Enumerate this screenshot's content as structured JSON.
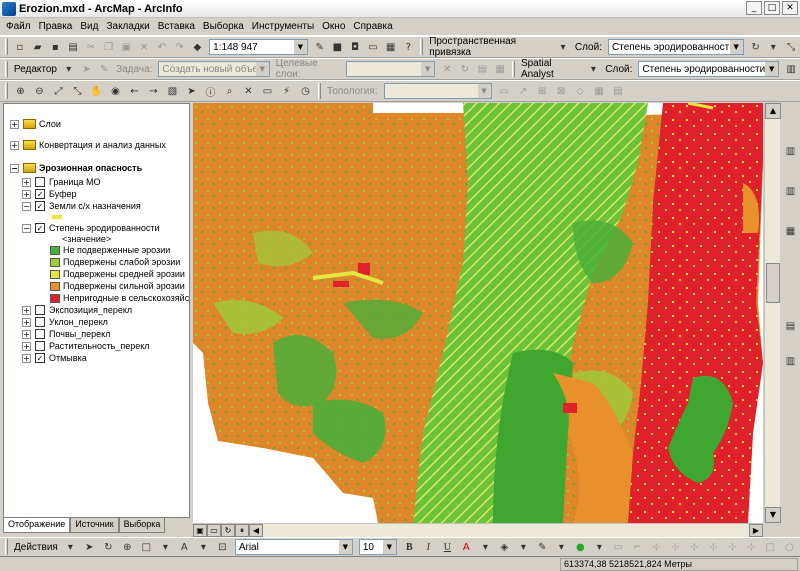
{
  "window": {
    "title": "Erozion.mxd - ArcMap - ArcInfo"
  },
  "menu": [
    "Файл",
    "Правка",
    "Вид",
    "Закладки",
    "Вставка",
    "Выборка",
    "Инструменты",
    "Окно",
    "Справка"
  ],
  "standard_toolbar": {
    "scale": "1:148 947",
    "spatial_ref_label": "Пространственная привязка",
    "layer_label": "Слой:",
    "layer_value": "Степень эродированности"
  },
  "editor_toolbar": {
    "editor_label": "Редактор",
    "task_label": "Задача:",
    "task_value": "Создать новый объект",
    "target_label": "Целевые слои:",
    "spatial_analyst_label": "Spatial Analyst",
    "layer_label": "Слой:",
    "layer_value": "Степень эродированности"
  },
  "tools_toolbar": {
    "topology_label": "Топология:"
  },
  "toc": {
    "items": [
      {
        "label": "Слои",
        "expand": "+"
      },
      {
        "label": "Конвертация и анализ данных",
        "expand": "+"
      },
      {
        "label": "Эрозионная опасность",
        "expand": "−"
      },
      {
        "label": "Граница МО",
        "expand": "+",
        "checked": false
      },
      {
        "label": "Буфер",
        "expand": "+",
        "checked": true
      },
      {
        "label": "Земли с/х назначения",
        "expand": "−",
        "checked": true
      },
      {
        "label": "Степень эродированности",
        "expand": "−",
        "checked": true
      },
      {
        "label": "<значение>"
      },
      {
        "label": "Не подверженные эрозии",
        "color": "#4caf3a"
      },
      {
        "label": "Подвержены слабой эрозии",
        "color": "#9ccc3c"
      },
      {
        "label": "Подвержены средней эрозии",
        "color": "#e6e640"
      },
      {
        "label": "Подвержены сильной эрозии",
        "color": "#e8902c"
      },
      {
        "label": "Непригодные в сельскохозяйстве",
        "color": "#e0202a"
      },
      {
        "label": "Экспозиция_перекл",
        "expand": "+",
        "checked": false
      },
      {
        "label": "Уклон_перекл",
        "expand": "+",
        "checked": false
      },
      {
        "label": "Почвы_перекл",
        "expand": "+",
        "checked": false
      },
      {
        "label": "Растительность_перекл",
        "expand": "+",
        "checked": false
      },
      {
        "label": "Отмывка",
        "expand": "+",
        "checked": true
      }
    ],
    "tabs": [
      "Отображение",
      "Источник",
      "Выборка"
    ]
  },
  "drawing_toolbar": {
    "actions_label": "Действия",
    "font": "Arial",
    "font_size": "10",
    "bold": "B",
    "italic": "I",
    "underline": "U"
  },
  "status": {
    "coords": "613374,38  5218521,824 Метры"
  },
  "colors": {
    "no_erosion": "#4caf3a",
    "weak": "#9ccc3c",
    "medium": "#e6e640",
    "strong": "#e8902c",
    "unfit": "#e0202a"
  }
}
